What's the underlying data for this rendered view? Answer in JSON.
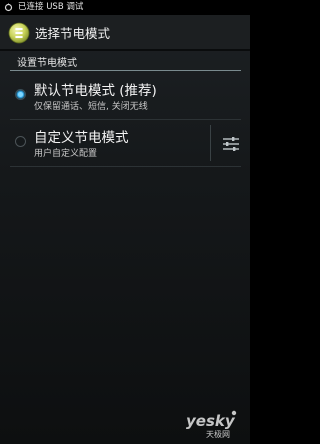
{
  "status_bar": {
    "usb_icon": "usb-debug-icon",
    "text": "已连接 USB 调试"
  },
  "action_bar": {
    "app_icon": "power-saving-app-icon",
    "title": "选择节电模式"
  },
  "section": {
    "header": "设置节电模式"
  },
  "options": [
    {
      "title": "默认节电模式 (推荐)",
      "summary": "仅保留通话、短信, 关闭无线",
      "selected": true
    },
    {
      "title": "自定义节电模式",
      "summary": "用户自定义配置",
      "selected": false,
      "settings_icon": "sliders-settings-icon"
    }
  ],
  "watermark": {
    "brand": "yesky",
    "sub": "天极网"
  },
  "colors": {
    "accent": "#33b5e5",
    "background": "#15181a",
    "text_primary": "#f4f4f4"
  }
}
